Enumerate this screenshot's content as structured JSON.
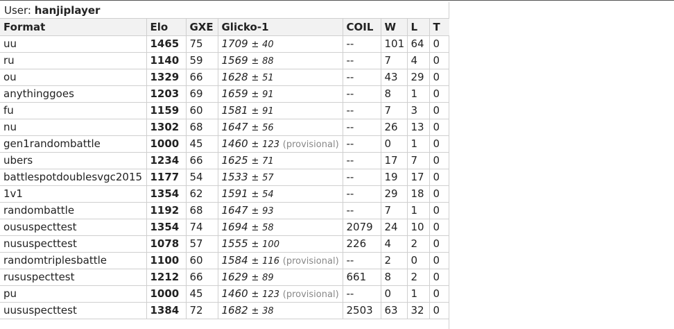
{
  "user": {
    "label": "User:",
    "name": "hanjiplayer"
  },
  "columns": [
    "Format",
    "Elo",
    "GXE",
    "Glicko-1",
    "COIL",
    "W",
    "L",
    "T"
  ],
  "rows": [
    {
      "format": "uu",
      "elo": "1465",
      "gxe": "75",
      "glicko": "1709",
      "pm": "±",
      "rd": "40",
      "provisional": "",
      "coil": "--",
      "w": "101",
      "l": "64",
      "t": "0"
    },
    {
      "format": "ru",
      "elo": "1140",
      "gxe": "59",
      "glicko": "1569",
      "pm": "±",
      "rd": "88",
      "provisional": "",
      "coil": "--",
      "w": "7",
      "l": "4",
      "t": "0"
    },
    {
      "format": "ou",
      "elo": "1329",
      "gxe": "66",
      "glicko": "1628",
      "pm": "±",
      "rd": "51",
      "provisional": "",
      "coil": "--",
      "w": "43",
      "l": "29",
      "t": "0"
    },
    {
      "format": "anythinggoes",
      "elo": "1203",
      "gxe": "69",
      "glicko": "1659",
      "pm": "±",
      "rd": "91",
      "provisional": "",
      "coil": "--",
      "w": "8",
      "l": "1",
      "t": "0"
    },
    {
      "format": "fu",
      "elo": "1159",
      "gxe": "60",
      "glicko": "1581",
      "pm": "±",
      "rd": "91",
      "provisional": "",
      "coil": "--",
      "w": "7",
      "l": "3",
      "t": "0"
    },
    {
      "format": "nu",
      "elo": "1302",
      "gxe": "68",
      "glicko": "1647",
      "pm": "±",
      "rd": "56",
      "provisional": "",
      "coil": "--",
      "w": "26",
      "l": "13",
      "t": "0"
    },
    {
      "format": "gen1randombattle",
      "elo": "1000",
      "gxe": "45",
      "glicko": "1460",
      "pm": "±",
      "rd": "123",
      "provisional": "(provisional)",
      "coil": "--",
      "w": "0",
      "l": "1",
      "t": "0"
    },
    {
      "format": "ubers",
      "elo": "1234",
      "gxe": "66",
      "glicko": "1625",
      "pm": "±",
      "rd": "71",
      "provisional": "",
      "coil": "--",
      "w": "17",
      "l": "7",
      "t": "0"
    },
    {
      "format": "battlespotdoublesvgc2015",
      "elo": "1177",
      "gxe": "54",
      "glicko": "1533",
      "pm": "±",
      "rd": "57",
      "provisional": "",
      "coil": "--",
      "w": "19",
      "l": "17",
      "t": "0"
    },
    {
      "format": "1v1",
      "elo": "1354",
      "gxe": "62",
      "glicko": "1591",
      "pm": "±",
      "rd": "54",
      "provisional": "",
      "coil": "--",
      "w": "29",
      "l": "18",
      "t": "0"
    },
    {
      "format": "randombattle",
      "elo": "1192",
      "gxe": "68",
      "glicko": "1647",
      "pm": "±",
      "rd": "93",
      "provisional": "",
      "coil": "--",
      "w": "7",
      "l": "1",
      "t": "0"
    },
    {
      "format": "oususpecttest",
      "elo": "1354",
      "gxe": "74",
      "glicko": "1694",
      "pm": "±",
      "rd": "58",
      "provisional": "",
      "coil": "2079",
      "w": "24",
      "l": "10",
      "t": "0"
    },
    {
      "format": "nususpecttest",
      "elo": "1078",
      "gxe": "57",
      "glicko": "1555",
      "pm": "±",
      "rd": "100",
      "provisional": "",
      "coil": "226",
      "w": "4",
      "l": "2",
      "t": "0"
    },
    {
      "format": "randomtriplesbattle",
      "elo": "1100",
      "gxe": "60",
      "glicko": "1584",
      "pm": "±",
      "rd": "116",
      "provisional": "(provisional)",
      "coil": "--",
      "w": "2",
      "l": "0",
      "t": "0"
    },
    {
      "format": "rususpecttest",
      "elo": "1212",
      "gxe": "66",
      "glicko": "1629",
      "pm": "±",
      "rd": "89",
      "provisional": "",
      "coil": "661",
      "w": "8",
      "l": "2",
      "t": "0"
    },
    {
      "format": "pu",
      "elo": "1000",
      "gxe": "45",
      "glicko": "1460",
      "pm": "±",
      "rd": "123",
      "provisional": "(provisional)",
      "coil": "--",
      "w": "0",
      "l": "1",
      "t": "0"
    },
    {
      "format": "uususpecttest",
      "elo": "1384",
      "gxe": "72",
      "glicko": "1682",
      "pm": "±",
      "rd": "38",
      "provisional": "",
      "coil": "2503",
      "w": "63",
      "l": "32",
      "t": "0"
    }
  ]
}
